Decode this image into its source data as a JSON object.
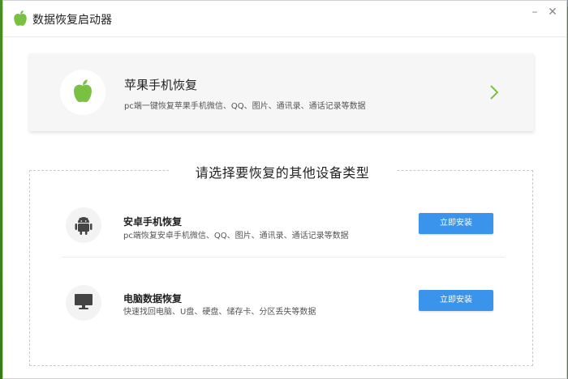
{
  "window": {
    "title": "数据恢复启动器",
    "minimize_label": "–",
    "close_label": "✕"
  },
  "featured": {
    "title": "苹果手机恢复",
    "description": "pc端一键恢复苹果手机微信、QQ、图片、通讯录、通话记录等数据",
    "icon": "apple-icon",
    "chevron": "chevron-right-icon"
  },
  "other_section": {
    "heading": "请选择要恢复的其他设备类型",
    "devices": [
      {
        "title": "安卓手机恢复",
        "description": "pc端恢复安卓手机微信、QQ、图片、通讯录、通话记录等数据",
        "button": "立即安装",
        "icon": "android-icon"
      },
      {
        "title": "电脑数据恢复",
        "description": "快速找回电脑、U盘、硬盘、储存卡、分区丢失等数据",
        "button": "立即安装",
        "icon": "monitor-icon"
      }
    ]
  },
  "colors": {
    "accent": "#3a94ec",
    "apple_green": "#7ac143",
    "chevron_green": "#7ac143"
  }
}
